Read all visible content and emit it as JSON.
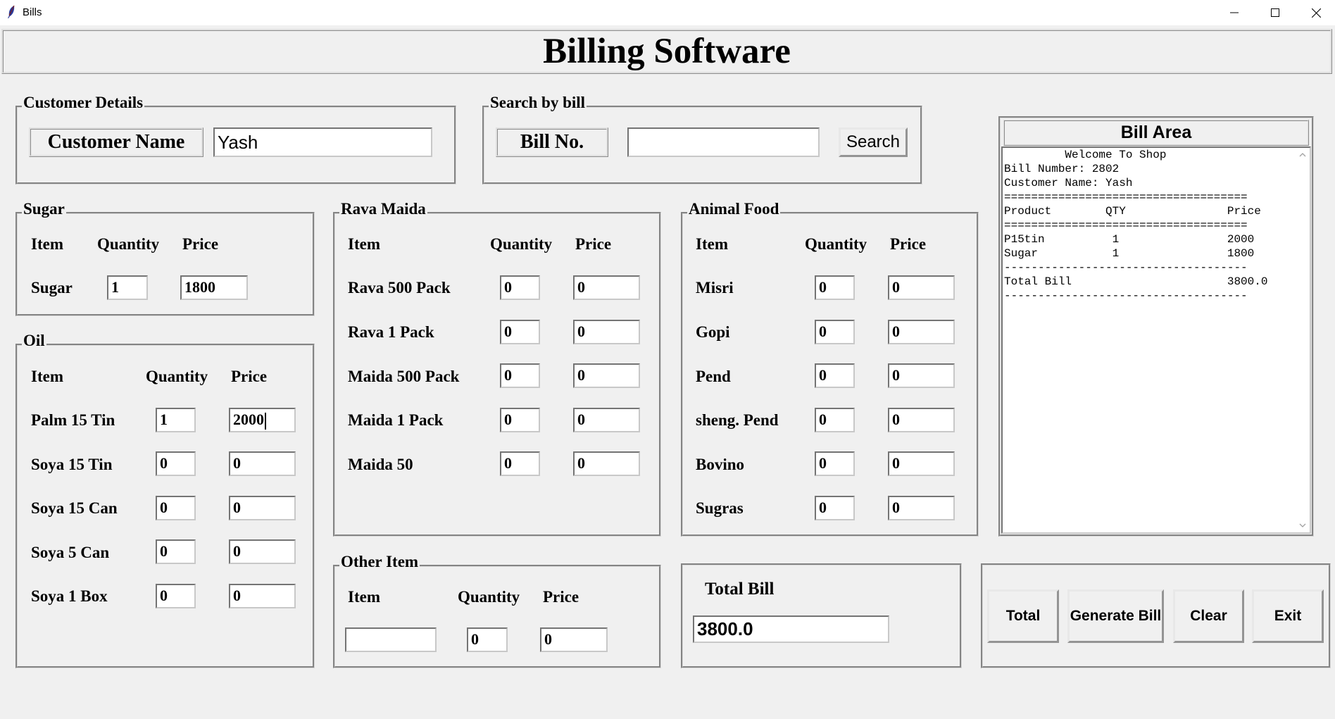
{
  "window": {
    "title": "Bills"
  },
  "heading": "Billing Software",
  "customer": {
    "frame_title": "Customer Details",
    "name_label": "Customer Name",
    "name_value": "Yash"
  },
  "search": {
    "frame_title": "Search by bill",
    "bill_label": "Bill No.",
    "bill_value": "",
    "button": "Search"
  },
  "sugar": {
    "frame_title": "Sugar",
    "headers": {
      "item": "Item",
      "qty": "Quantity",
      "price": "Price"
    },
    "rows": [
      {
        "item": "Sugar",
        "qty": "1",
        "price": "1800"
      }
    ]
  },
  "oil": {
    "frame_title": "Oil",
    "headers": {
      "item": "Item",
      "qty": "Quantity",
      "price": "Price"
    },
    "rows": [
      {
        "item": "Palm 15 Tin",
        "qty": "1",
        "price": "2000"
      },
      {
        "item": "Soya 15 Tin",
        "qty": "0",
        "price": "0"
      },
      {
        "item": "Soya 15 Can",
        "qty": "0",
        "price": "0"
      },
      {
        "item": "Soya 5 Can",
        "qty": "0",
        "price": "0"
      },
      {
        "item": "Soya 1 Box",
        "qty": "0",
        "price": "0"
      }
    ]
  },
  "rava": {
    "frame_title": "Rava Maida",
    "headers": {
      "item": "Item",
      "qty": "Quantity",
      "price": "Price"
    },
    "rows": [
      {
        "item": "Rava 500 Pack",
        "qty": "0",
        "price": "0"
      },
      {
        "item": "Rava 1 Pack",
        "qty": "0",
        "price": "0"
      },
      {
        "item": "Maida 500 Pack",
        "qty": "0",
        "price": "0"
      },
      {
        "item": "Maida 1 Pack",
        "qty": "0",
        "price": "0"
      },
      {
        "item": "Maida 50",
        "qty": "0",
        "price": "0"
      }
    ]
  },
  "animal": {
    "frame_title": "Animal Food",
    "headers": {
      "item": "Item",
      "qty": "Quantity",
      "price": "Price"
    },
    "rows": [
      {
        "item": "Misri",
        "qty": "0",
        "price": "0"
      },
      {
        "item": "Gopi",
        "qty": "0",
        "price": "0"
      },
      {
        "item": "Pend",
        "qty": "0",
        "price": "0"
      },
      {
        "item": "sheng. Pend",
        "qty": "0",
        "price": "0"
      },
      {
        "item": "Bovino",
        "qty": "0",
        "price": "0"
      },
      {
        "item": "Sugras",
        "qty": "0",
        "price": "0"
      }
    ]
  },
  "other": {
    "frame_title": "Other Item",
    "headers": {
      "item": "Item",
      "qty": "Quantity",
      "price": "Price"
    },
    "item_value": "",
    "qty_value": "0",
    "price_value": "0"
  },
  "total": {
    "label": "Total Bill",
    "value": "3800.0"
  },
  "buttons": {
    "total": "Total",
    "generate": "Generate Bill",
    "clear": "Clear",
    "exit": "Exit"
  },
  "bill_area": {
    "title": "Bill Area",
    "lines": [
      "         Welcome To Shop",
      "Bill Number: 2802",
      "Customer Name: Yash",
      "====================================",
      "Product        QTY               Price",
      "====================================",
      "P15tin          1                2000",
      "Sugar           1                1800",
      "------------------------------------",
      "Total Bill                       3800.0",
      "------------------------------------"
    ]
  }
}
